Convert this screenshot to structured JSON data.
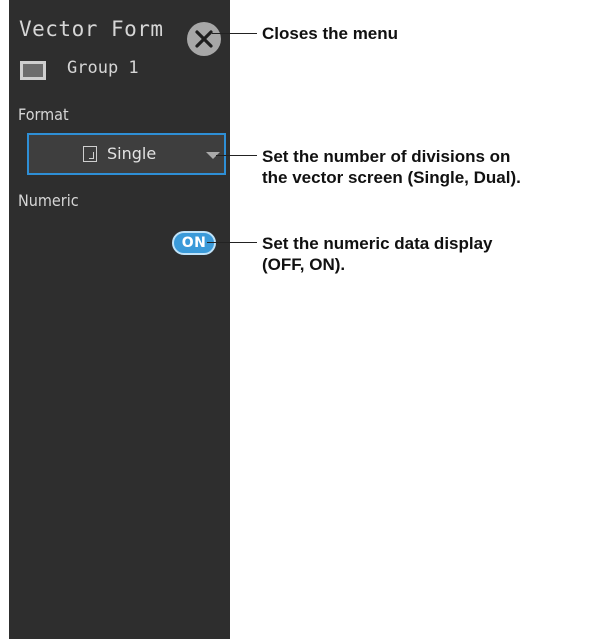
{
  "menu": {
    "title": "Vector Form",
    "group_label": "Group 1",
    "format_label": "Format",
    "format_value": "Single",
    "numeric_label": "Numeric",
    "numeric_toggle": "ON"
  },
  "annotations": {
    "close": "Closes the menu",
    "format_line1": "Set the number of divisions on",
    "format_line2": "the vector screen (Single, Dual).",
    "numeric_line1": "Set the numeric data display",
    "numeric_line2": "(OFF, ON)."
  },
  "icons": {
    "close": "close-icon",
    "group": "display-group-icon",
    "format": "single-screen-icon",
    "dropdown": "chevron-down-icon"
  },
  "colors": {
    "panel_bg": "#2e2e2e",
    "select_border": "#2e8fd6",
    "toggle_on": "#3a9ad9",
    "close_button": "#a7a7a7"
  }
}
